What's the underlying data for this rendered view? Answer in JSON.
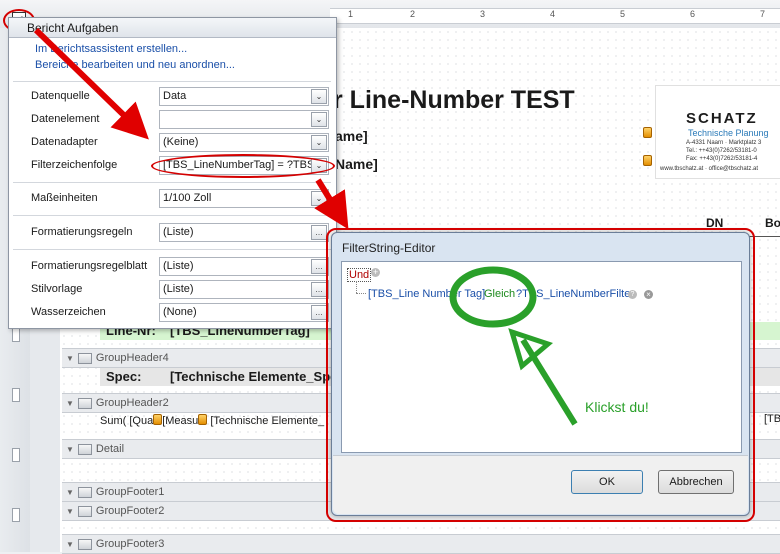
{
  "ruler": {
    "numbers": [
      "1",
      "2",
      "3",
      "4",
      "5",
      "6",
      "7"
    ]
  },
  "report": {
    "title": "r Line-Number TEST",
    "field1": "ame]",
    "field2": "Name]",
    "col_dn": "DN",
    "col_bo": "Bo",
    "line_nr_label": "Line-Nr:",
    "line_nr_value": "[TBS_LineNumberTag]",
    "spec_label": "Spec:",
    "spec_value": "[Technische Elemente_Spe",
    "sum_text": "Sum( [Qua",
    "sum_text2": "[Measu",
    "sum_text3": "[Technische Elemente_",
    "sum_right": "[TB",
    "logo": {
      "name": "SCHATZ",
      "tagline": "Technische Planung",
      "address": "A-4331 Naarn · Marktplatz 3",
      "tel": "Tel.: ++43(0)7262/53181-0",
      "fax": "Fax: ++43(0)7262/53181-4",
      "web": "www.tbschatz.at · office@tbschatz.at",
      "color": "#2a7ab8"
    }
  },
  "bands": [
    {
      "label": "GroupHeader4"
    },
    {
      "label": "GroupHeader2"
    },
    {
      "label": "Detail"
    },
    {
      "label": "GroupFooter1"
    },
    {
      "label": "GroupFooter2"
    },
    {
      "label": "GroupFooter3"
    }
  ],
  "task_panel": {
    "title": "Bericht Aufgaben",
    "links": [
      "Im Berichtsassistent erstellen...",
      "Bereiche bearbeiten und neu anordnen..."
    ],
    "rows": [
      {
        "label": "Datenquelle",
        "value": "Data",
        "button": "dropdown"
      },
      {
        "label": "Datenelement",
        "value": "",
        "button": "dropdown"
      },
      {
        "label": "Datenadapter",
        "value": "(Keine)",
        "button": "dropdown"
      },
      {
        "label": "Filterzeichenfolge",
        "value": "[TBS_LineNumberTag] = ?TBS_Lin",
        "button": "dropdown"
      },
      {
        "label": "Maßeinheiten",
        "value": "1/100 Zoll",
        "button": "dropdown"
      },
      {
        "label": "Formatierungsregeln",
        "value": "(Liste)",
        "button": "ellipsis"
      },
      {
        "label": "Formatierungsregelblatt",
        "value": "(Liste)",
        "button": "ellipsis"
      },
      {
        "label": "Stilvorlage",
        "value": "(Liste)",
        "button": "ellipsis"
      },
      {
        "label": "Wasserzeichen",
        "value": "(None)",
        "button": "ellipsis"
      }
    ]
  },
  "dialog": {
    "title": "FilterString-Editor",
    "root_op": "Und",
    "cond_field": "[TBS_Line Number Tag]",
    "cond_op": "Gleich",
    "cond_value": "?TBS_LineNumberFilter",
    "ok": "OK",
    "cancel": "Abbrechen"
  },
  "annotation": {
    "text": "Klickst du!",
    "color": "#2aa02a"
  },
  "colors": {
    "arrow": "#e00000",
    "highlight": "#d40000",
    "band_green": "#d6f5d0"
  }
}
